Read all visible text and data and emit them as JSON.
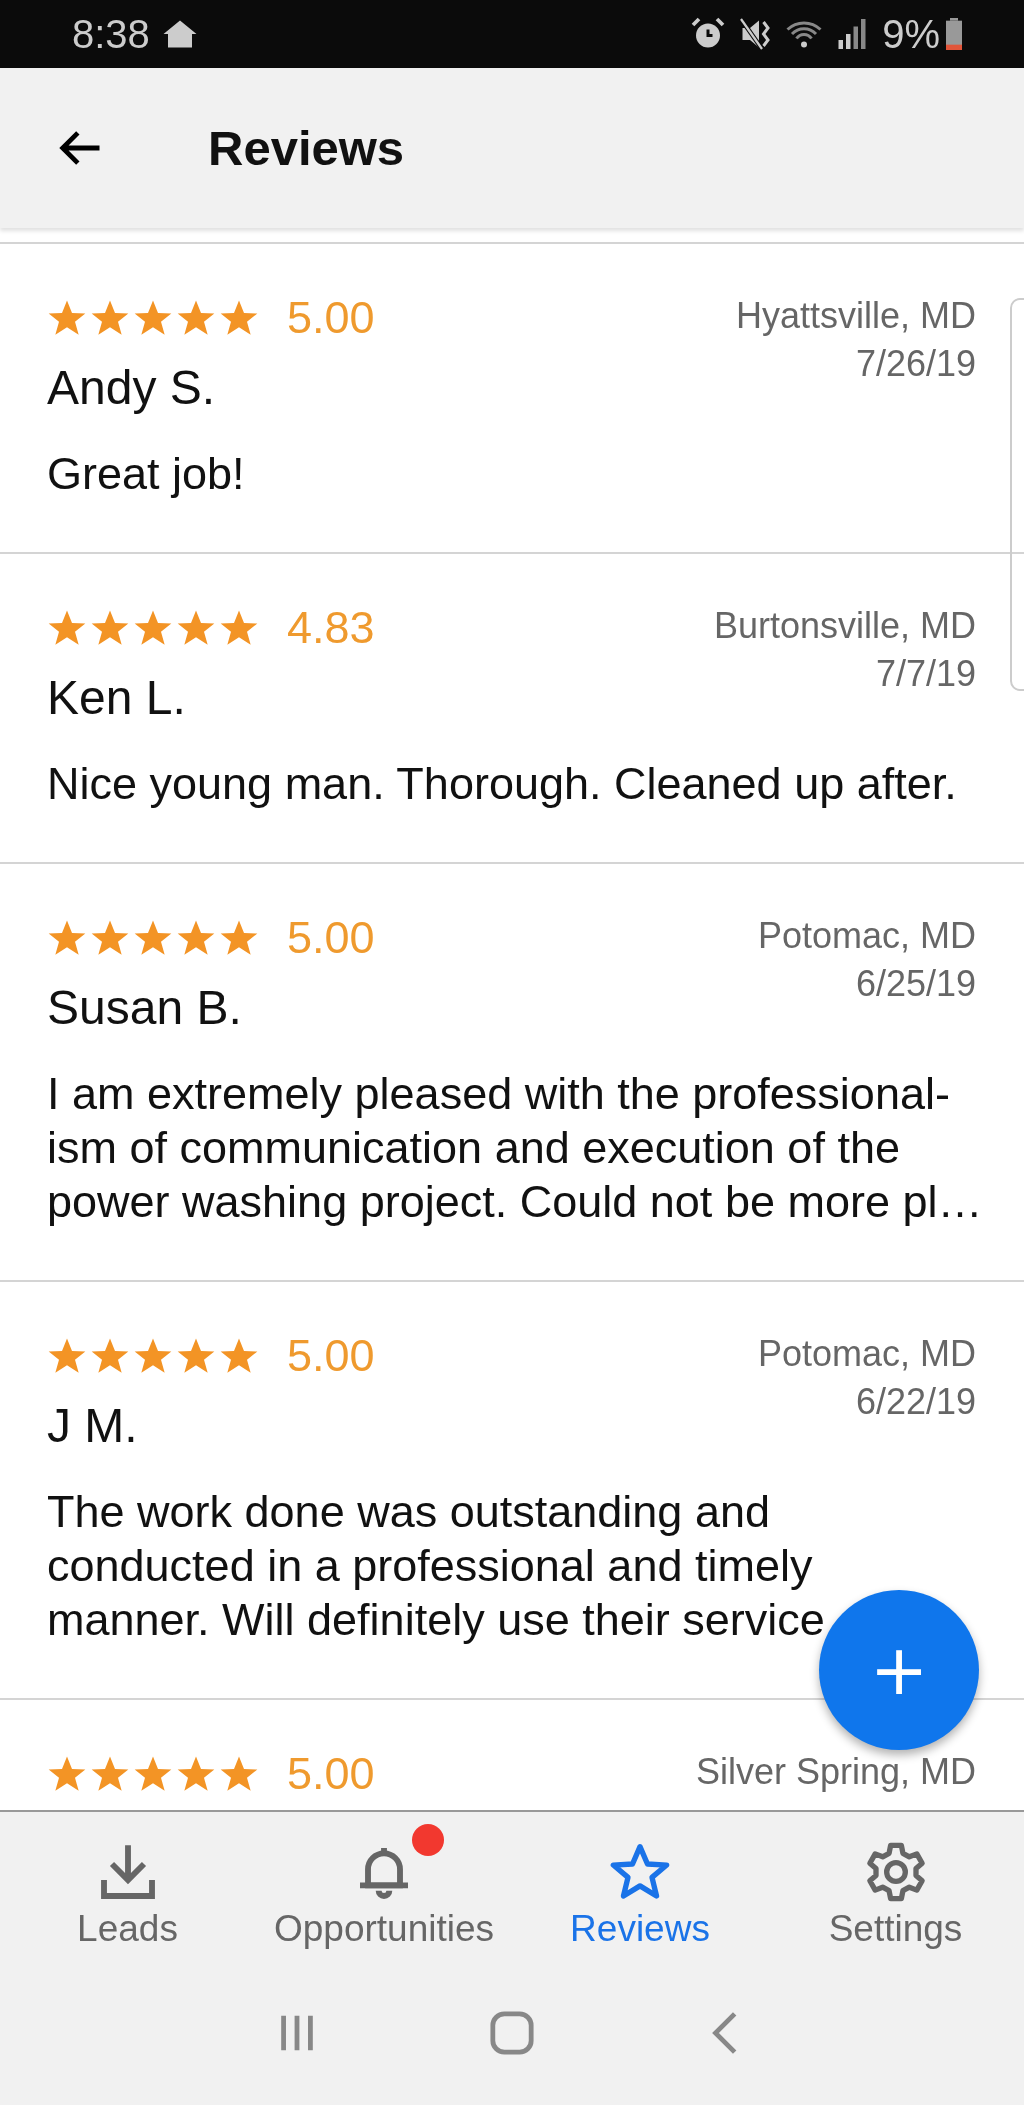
{
  "status_bar": {
    "time": "8:38",
    "battery": "9%"
  },
  "app_bar": {
    "title": "Reviews"
  },
  "reviews": [
    {
      "stars": 5,
      "rating": "5.00",
      "name": "Andy S.",
      "location": "Hyattsville, MD",
      "date": "7/26/19",
      "body_lines": [
        "Great job!"
      ]
    },
    {
      "stars": 5,
      "rating": "4.83",
      "name": "Ken L.",
      "location": "Burtonsville, MD",
      "date": "7/7/19",
      "body_lines": [
        "Nice young man. Thorough. Cleaned up after."
      ]
    },
    {
      "stars": 5,
      "rating": "5.00",
      "name": "Susan B.",
      "location": "Potomac, MD",
      "date": "6/25/19",
      "body_lines": [
        "I am extremely pleased with the professional-",
        "ism of communication and execution of the",
        "power washing project. Could not be more pl…"
      ]
    },
    {
      "stars": 5,
      "rating": "5.00",
      "name": "J M.",
      "location": "Potomac, MD",
      "date": "6/22/19",
      "body_lines": [
        "The work done was outstanding and",
        "conducted in a professional and timely",
        "manner. Will definitely use their service"
      ]
    },
    {
      "stars": 5,
      "rating": "5.00",
      "location": "Silver Spring, MD"
    }
  ],
  "fab": {
    "label": "+"
  },
  "bottom_nav": [
    {
      "label": "Leads",
      "selected": false,
      "badge": false
    },
    {
      "label": "Opportunities",
      "selected": false,
      "badge": true
    },
    {
      "label": "Reviews",
      "selected": true,
      "badge": false
    },
    {
      "label": "Settings",
      "selected": false,
      "badge": false
    }
  ]
}
